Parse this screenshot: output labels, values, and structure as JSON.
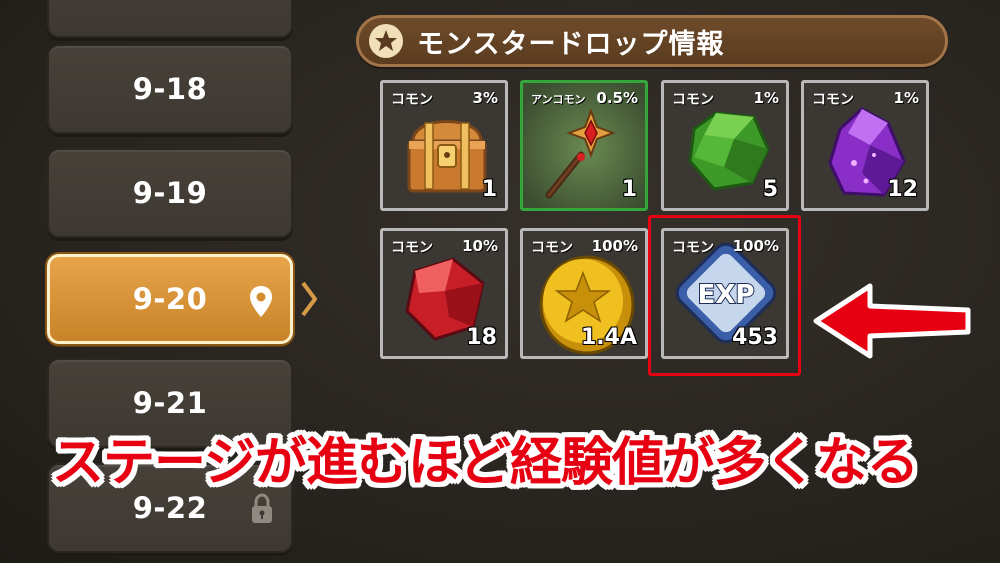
{
  "stages": [
    {
      "label": "",
      "state": "normal"
    },
    {
      "label": "9-18",
      "state": "normal"
    },
    {
      "label": "9-19",
      "state": "normal"
    },
    {
      "label": "9-20",
      "state": "active"
    },
    {
      "label": "9-21",
      "state": "normal"
    },
    {
      "label": "9-22",
      "state": "locked"
    }
  ],
  "drop_panel": {
    "title": "モンスタードロップ情報",
    "items": [
      {
        "rarity": "コモン",
        "rate": "3%",
        "qty": "1",
        "icon": "treasure-chest-icon"
      },
      {
        "rarity": "アンコモン",
        "rate": "0.5%",
        "qty": "1",
        "icon": "staff-icon"
      },
      {
        "rarity": "コモン",
        "rate": "1%",
        "qty": "5",
        "icon": "green-gem-icon"
      },
      {
        "rarity": "コモン",
        "rate": "1%",
        "qty": "12",
        "icon": "purple-crystal-icon"
      },
      {
        "rarity": "コモン",
        "rate": "10%",
        "qty": "18",
        "icon": "red-gem-icon"
      },
      {
        "rarity": "コモン",
        "rate": "100%",
        "qty": "1.4A",
        "icon": "gold-coin-icon"
      },
      {
        "rarity": "コモン",
        "rate": "100%",
        "qty": "453",
        "icon": "exp-icon",
        "exp_label": "EXP"
      }
    ]
  },
  "caption": "ステージが進むほど経験値が多くなる",
  "colors": {
    "accent_red": "#e60012",
    "active_stage": "#d99238",
    "header_brown": "#654426"
  }
}
